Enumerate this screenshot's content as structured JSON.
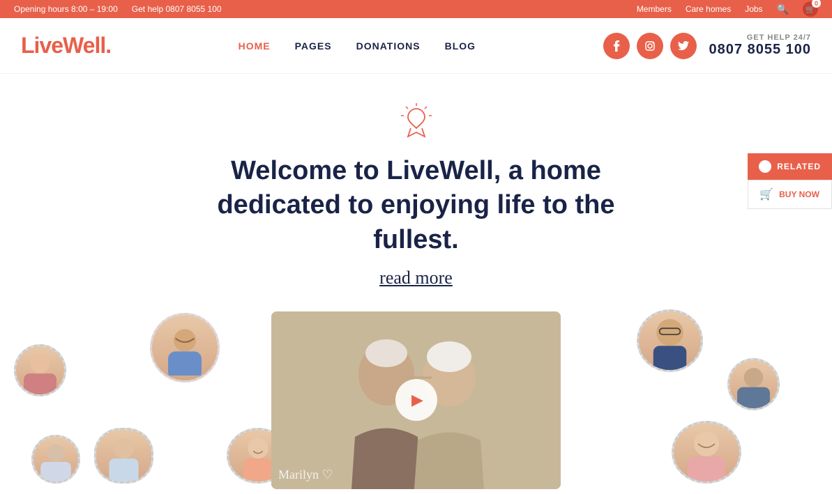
{
  "topbar": {
    "hours_label": "Opening hours 8:00 – 19:00",
    "help_label": "Get help 0807 8055 100",
    "members_label": "Members",
    "carehomes_label": "Care homes",
    "jobs_label": "Jobs",
    "cart_count": "0"
  },
  "nav": {
    "logo_text": "LiveWell",
    "logo_dot": ".",
    "links": [
      {
        "label": "HOME",
        "active": true
      },
      {
        "label": "PAGES",
        "active": false
      },
      {
        "label": "DONATIONS",
        "active": false
      },
      {
        "label": "BLOG",
        "active": false
      }
    ],
    "social": [
      {
        "name": "facebook",
        "icon": "f"
      },
      {
        "name": "instagram",
        "icon": "☆"
      },
      {
        "name": "twitter",
        "icon": "t"
      }
    ],
    "get_help_label": "GET HELP 24/7",
    "phone": "0807 8055 100"
  },
  "hero": {
    "title": "Welcome to LiveWell, a home dedicated to enjoying life to the fullest.",
    "read_more": "read more"
  },
  "related": {
    "related_label": "RELATED",
    "buy_now_label": "BUY NOW"
  },
  "video": {
    "overlay_text": "Marilyn ♡"
  }
}
